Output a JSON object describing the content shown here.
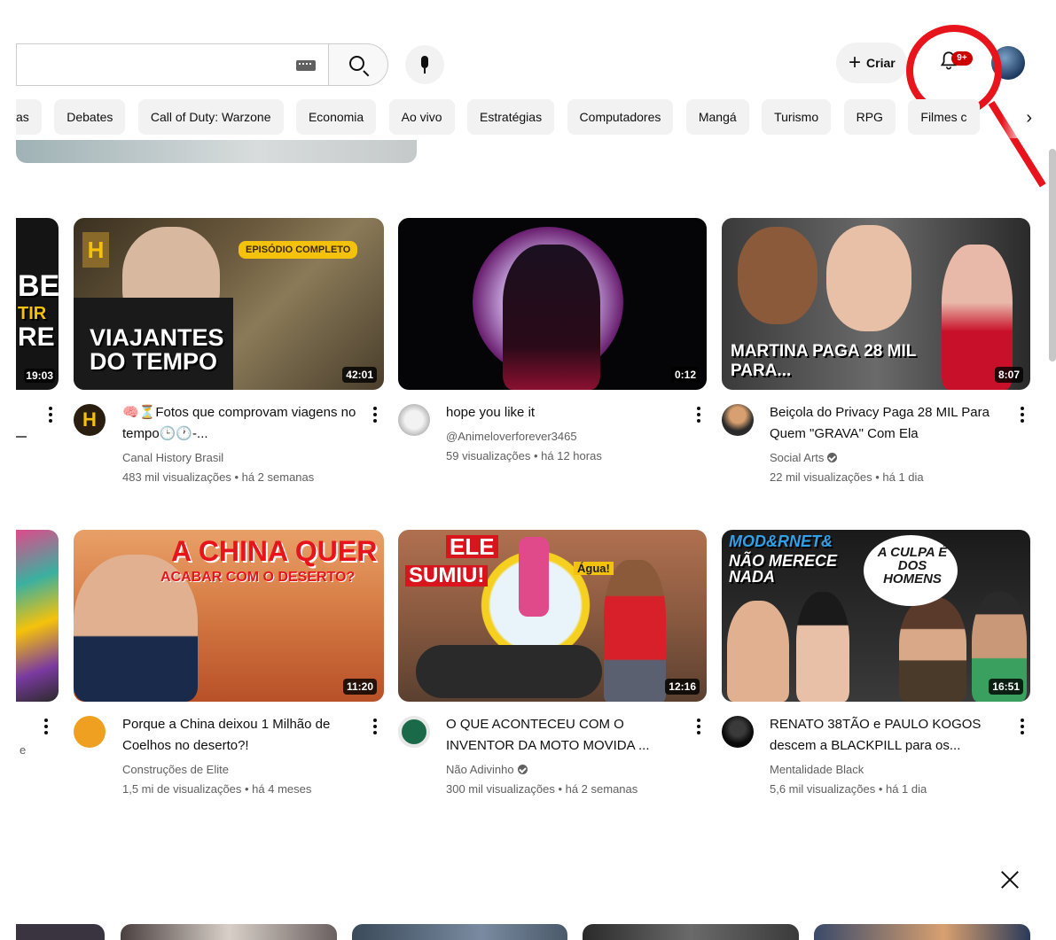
{
  "header": {
    "create_label": "Criar",
    "notification_badge": "9+"
  },
  "chips": [
    "as",
    "Debates",
    "Call of Duty: Warzone",
    "Economia",
    "Ao vivo",
    "Estratégias",
    "Computadores",
    "Mangá",
    "Turismo",
    "RPG",
    "Filmes c"
  ],
  "row1": [
    {
      "left_edge_texts": [
        "BEI",
        "TIR",
        "RE"
      ],
      "duration": "19:03"
    },
    {
      "thumb_text": "VIAJANTES DO TEMPO",
      "thumb_badge": "EPISÓDIO COMPLETO",
      "channel_logo": "H",
      "duration": "42:01",
      "title": "🧠⏳Fotos que comprovam viagens no tempo🕒🕐-...",
      "channel": "Canal History Brasil",
      "stats": "483 mil visualizações • há 2 semanas"
    },
    {
      "duration": "0:12",
      "title": "hope you like it",
      "channel": "@Animeloverforever3465",
      "stats": "59 visualizações • há 12 horas"
    },
    {
      "thumb_text": "MARTINA PAGA 28 MIL PARA...",
      "duration": "8:07",
      "title": "Beiçola do Privacy Paga 28 MIL Para Quem \"GRAVA\" Com Ela",
      "channel": "Social Arts",
      "stats": "22 mil visualizações • há 1 dia"
    }
  ],
  "row2": [
    {
      "left_edge_text": "e"
    },
    {
      "thumb_text_1": "A CHINA QUER",
      "thumb_text_2": "ACABAR COM O DESERTO?",
      "duration": "11:20",
      "title": "Porque a China deixou 1 Milhão de Coelhos no deserto?!",
      "channel": "Construções de Elite",
      "stats": "1,5 mi de visualizações • há 4 meses"
    },
    {
      "thumb_text_1": "ELE",
      "thumb_text_2": "SUMIU!",
      "thumb_text_3": "Água!",
      "duration": "12:16",
      "title": "O QUE ACONTECEU COM O INVENTOR DA MOTO MOVIDA ...",
      "channel": "Não Adivinho",
      "stats": "300 mil visualizações • há 2 semanas"
    },
    {
      "thumb_text_1": "MOD&RNET&",
      "thumb_text_2": "NÃO MERECE NADA",
      "thumb_text_3": "A CULPA É DOS HOMENS",
      "duration": "16:51",
      "title": "RENATO 38TÃO e PAULO KOGOS descem a BLACKPILL para os...",
      "channel": "Mentalidade Black",
      "stats": "5,6 mil visualizações • há 1 dia"
    }
  ],
  "icons": {
    "keyboard": "keyboard-icon",
    "search": "search-icon",
    "mic": "microphone-icon",
    "plus": "plus-icon",
    "bell": "bell-icon",
    "chevron": "chevron-right-icon",
    "close": "close-icon",
    "kebab": "more-vert-icon",
    "verified": "verified-check-icon"
  },
  "colors": {
    "annotation": "#e8141c",
    "badge": "#cc0000",
    "chip_bg": "#f2f2f2",
    "meta_text": "#606060"
  }
}
